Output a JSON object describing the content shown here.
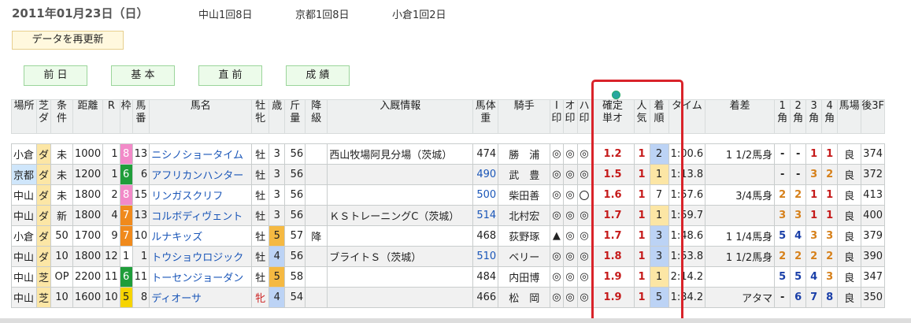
{
  "header": {
    "date": "2011年01月23日（日）",
    "venues": [
      "中山1回8日",
      "京都1回8日",
      "小倉1回2日"
    ]
  },
  "refresh_label": "データを再更新",
  "nav": [
    "前 日",
    "基 本",
    "直 前",
    "成 績"
  ],
  "columns": [
    {
      "key": "venue",
      "label": "場所"
    },
    {
      "key": "surface",
      "label": "芝ダ"
    },
    {
      "key": "cond",
      "label": "条件"
    },
    {
      "key": "dist",
      "label": "距離"
    },
    {
      "key": "race",
      "label": "R"
    },
    {
      "key": "frame",
      "label": "枠"
    },
    {
      "key": "horseno",
      "label": "馬番"
    },
    {
      "key": "name",
      "label": "馬名"
    },
    {
      "key": "sex",
      "label": "牡牝"
    },
    {
      "key": "age",
      "label": "歳"
    },
    {
      "key": "weight",
      "label": "斤量"
    },
    {
      "key": "drop",
      "label": "降級"
    },
    {
      "key": "stable",
      "label": "入厩情報"
    },
    {
      "key": "bodyw",
      "label": "馬体重"
    },
    {
      "key": "jockey",
      "label": "騎手"
    },
    {
      "key": "i",
      "label": "I印"
    },
    {
      "key": "o",
      "label": "オ印"
    },
    {
      "key": "h",
      "label": "ハ印"
    },
    {
      "key": "odds",
      "label": "確定単オ"
    },
    {
      "key": "pop",
      "label": "人気"
    },
    {
      "key": "place",
      "label": "着順"
    },
    {
      "key": "time",
      "label": "タイム"
    },
    {
      "key": "margin",
      "label": "着差"
    },
    {
      "key": "c1",
      "label": "1角"
    },
    {
      "key": "c2",
      "label": "2角"
    },
    {
      "key": "c3",
      "label": "3角"
    },
    {
      "key": "c4",
      "label": "4角"
    },
    {
      "key": "track",
      "label": "馬場"
    },
    {
      "key": "last3f",
      "label": "後3F"
    }
  ],
  "rows": [
    {
      "venue": "小倉",
      "surface": "ダ",
      "cond": "未",
      "dist": "1000",
      "race": "1",
      "frame": "8",
      "horseno": "13",
      "name": "ニシノショータイム",
      "sex": "牡",
      "age": "3",
      "weight": "56",
      "drop": "",
      "stable": "西山牧場阿見分場（茨城）",
      "bodyw": "474",
      "jockey": "勝　浦",
      "i": "◎",
      "o": "◎",
      "h": "◎",
      "odds": "1.2",
      "pop": "1",
      "place": "2",
      "time": "1:00.6",
      "margin": "1 1/2馬身",
      "c1": "-",
      "c2": "-",
      "c3": "1",
      "c4": "1",
      "track": "良",
      "last3f": "374"
    },
    {
      "venue": "京都",
      "surface": "ダ",
      "cond": "未",
      "dist": "1200",
      "race": "1",
      "frame": "6",
      "horseno": "6",
      "name": "アフリカンハンター",
      "sex": "牡",
      "age": "3",
      "weight": "56",
      "drop": "",
      "stable": "",
      "bodyw": "490",
      "jockey": "武　豊",
      "i": "◎",
      "o": "◎",
      "h": "◎",
      "odds": "1.5",
      "pop": "1",
      "place": "1",
      "time": "1:13.8",
      "margin": "",
      "c1": "-",
      "c2": "-",
      "c3": "3",
      "c4": "2",
      "track": "良",
      "last3f": "372"
    },
    {
      "venue": "中山",
      "surface": "ダ",
      "cond": "未",
      "dist": "1800",
      "race": "2",
      "frame": "8",
      "horseno": "15",
      "name": "リンガスクリフ",
      "sex": "牡",
      "age": "3",
      "weight": "56",
      "drop": "",
      "stable": "",
      "bodyw": "500",
      "jockey": "柴田善",
      "i": "◎",
      "o": "◎",
      "h": "〇",
      "odds": "1.6",
      "pop": "1",
      "place": "7",
      "time": "1:57.6",
      "margin": "3/4馬身",
      "c1": "2",
      "c2": "2",
      "c3": "1",
      "c4": "1",
      "track": "良",
      "last3f": "413"
    },
    {
      "venue": "中山",
      "surface": "ダ",
      "cond": "新",
      "dist": "1800",
      "race": "4",
      "frame": "7",
      "horseno": "13",
      "name": "コルボディヴェント",
      "sex": "牡",
      "age": "3",
      "weight": "56",
      "drop": "",
      "stable": "ＫＳトレーニングC（茨城）",
      "bodyw": "514",
      "jockey": "北村宏",
      "i": "◎",
      "o": "◎",
      "h": "◎",
      "odds": "1.7",
      "pop": "1",
      "place": "1",
      "time": "1:59.7",
      "margin": "",
      "c1": "3",
      "c2": "3",
      "c3": "1",
      "c4": "1",
      "track": "良",
      "last3f": "400"
    },
    {
      "venue": "小倉",
      "surface": "ダ",
      "cond": "50",
      "dist": "1700",
      "race": "9",
      "frame": "7",
      "horseno": "10",
      "name": "ルナキッズ",
      "sex": "牡",
      "age": "5",
      "weight": "57",
      "drop": "降",
      "stable": "",
      "bodyw": "468",
      "jockey": "荻野琢",
      "i": "▲",
      "o": "◎",
      "h": "◎",
      "odds": "1.7",
      "pop": "1",
      "place": "3",
      "time": "1:48.6",
      "margin": "1 1/4馬身",
      "c1": "5",
      "c2": "4",
      "c3": "3",
      "c4": "3",
      "track": "良",
      "last3f": "379"
    },
    {
      "venue": "中山",
      "surface": "ダ",
      "cond": "10",
      "dist": "1800",
      "race": "12",
      "frame": "1",
      "horseno": "1",
      "name": "トウショウロジック",
      "sex": "牡",
      "age": "4",
      "weight": "56",
      "drop": "",
      "stable": "ブライトＳ（茨城）",
      "bodyw": "510",
      "jockey": "ベリー",
      "i": "◎",
      "o": "◎",
      "h": "◎",
      "odds": "1.8",
      "pop": "1",
      "place": "3",
      "time": "1:53.8",
      "margin": "1 1/2馬身",
      "c1": "2",
      "c2": "2",
      "c3": "2",
      "c4": "2",
      "track": "良",
      "last3f": "390"
    },
    {
      "venue": "中山",
      "surface": "芝",
      "cond": "OP",
      "dist": "2200",
      "race": "11",
      "frame": "6",
      "horseno": "11",
      "name": "トーセンジョーダン",
      "sex": "牡",
      "age": "5",
      "weight": "58",
      "drop": "",
      "stable": "",
      "bodyw": "484",
      "jockey": "内田博",
      "i": "◎",
      "o": "◎",
      "h": "◎",
      "odds": "1.9",
      "pop": "1",
      "place": "1",
      "time": "2:14.2",
      "margin": "",
      "c1": "5",
      "c2": "5",
      "c3": "4",
      "c4": "3",
      "track": "良",
      "last3f": "347"
    },
    {
      "venue": "中山",
      "surface": "芝",
      "cond": "10",
      "dist": "1600",
      "race": "10",
      "frame": "5",
      "horseno": "8",
      "name": "ディオーサ",
      "sex": "牝",
      "age": "4",
      "weight": "54",
      "drop": "",
      "stable": "",
      "bodyw": "466",
      "jockey": "松　岡",
      "i": "◎",
      "o": "◎",
      "h": "◎",
      "odds": "1.9",
      "pop": "1",
      "place": "5",
      "time": "1:34.2",
      "margin": "アタマ",
      "c1": "-",
      "c2": "6",
      "c3": "7",
      "c4": "8",
      "track": "良",
      "last3f": "350"
    }
  ],
  "colors": {
    "frame": {
      "1": "#ffffff",
      "5": "#f6d400",
      "6": "#1f9d3a",
      "7": "#f08a1c",
      "8": "#f28ac8"
    },
    "highlight": "#d9232a"
  }
}
